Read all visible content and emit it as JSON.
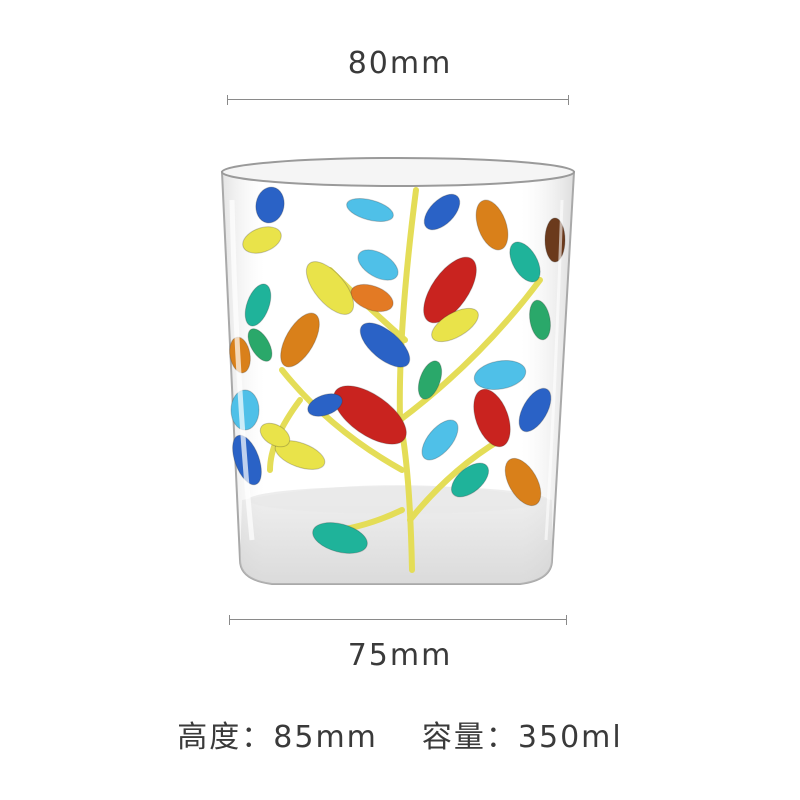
{
  "dimensions": {
    "top_width": "80mm",
    "bottom_width": "75mm"
  },
  "specs": {
    "height_label": "高度：",
    "height_value": "85mm",
    "capacity_label": "容量：",
    "capacity_value": "350ml"
  },
  "image": {
    "subject_icon": "painted-glass-tumbler-image",
    "colors": {
      "red": "#c9231f",
      "orange": "#d9801a",
      "yellow": "#e9e34a",
      "teal": "#1fb39a",
      "blue": "#2a62c6",
      "sky": "#4fc0e8",
      "green": "#2aa86a"
    }
  }
}
